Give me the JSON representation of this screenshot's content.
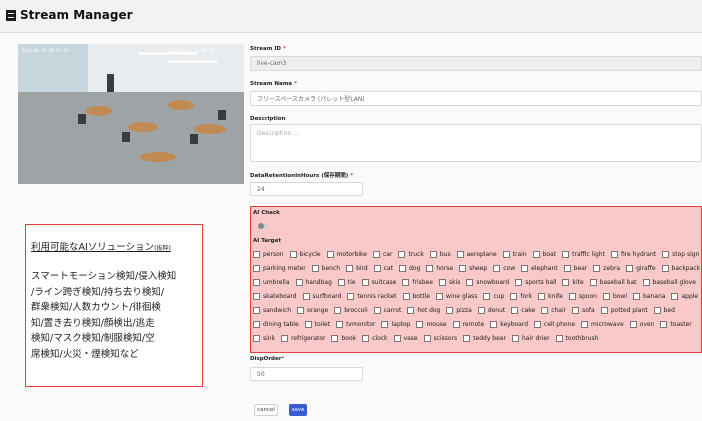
{
  "window": {
    "title": "Stream Manager"
  },
  "camera": {
    "overlay_left": "2021-06-25 18:12:33",
    "overlay_right": "2021-06-23 19:46:19"
  },
  "solution": {
    "title": "利用可能なAIソリューション",
    "title_note": "(抜粋)",
    "lines": [
      "スマートモーション検知/侵入検知",
      "/ライン跨ぎ検知/持ち去り検知/",
      "群衆検知/人数カウント/徘徊検",
      "知/置き去り検知/顔検出/逃走",
      "検知/マスク検知/制服検知/空",
      "席検知/火災・煙検知など"
    ]
  },
  "form": {
    "stream_id": {
      "label": "Stream ID",
      "value": "live-cam3"
    },
    "stream_name": {
      "label": "Stream Name",
      "value": "フリースペースカメラ (パレット型LAN)"
    },
    "description": {
      "label": "Description",
      "placeholder": "Description ..."
    },
    "retention": {
      "label": "DataRetentionInHours (保存期間)",
      "value": "24"
    },
    "ai_check": {
      "label": "AI Check"
    },
    "ai_target": {
      "label": "AI Target",
      "options": [
        "person",
        "bicycle",
        "motorbike",
        "car",
        "truck",
        "bus",
        "aeroplane",
        "train",
        "boat",
        "traffic light",
        "fire hydrant",
        "stop sign",
        "parking meter",
        "bench",
        "bird",
        "cat",
        "dog",
        "horse",
        "sheep",
        "cow",
        "elephant",
        "bear",
        "zebra",
        "giraffe",
        "backpack",
        "umbrella",
        "handbag",
        "tie",
        "suitcase",
        "frisbee",
        "skis",
        "snowboard",
        "sports ball",
        "kite",
        "baseball bat",
        "baseball glove",
        "skateboard",
        "surfboard",
        "tennis racket",
        "bottle",
        "wine glass",
        "cup",
        "fork",
        "knife",
        "spoon",
        "bowl",
        "banana",
        "apple",
        "sandwich",
        "orange",
        "broccoli",
        "carrot",
        "hot dog",
        "pizza",
        "donut",
        "cake",
        "chair",
        "sofa",
        "potted plant",
        "bed",
        "dining table",
        "toilet",
        "tvmonitor",
        "laptop",
        "mouse",
        "remote",
        "keyboard",
        "cell phone",
        "microwave",
        "oven",
        "toaster",
        "sink",
        "refrigerator",
        "book",
        "clock",
        "vase",
        "scissors",
        "teddy bear",
        "hair drier",
        "toothbrush"
      ]
    },
    "disp_order": {
      "label": "DispOrder",
      "value": "50"
    }
  },
  "buttons": {
    "cancel": "cancel",
    "save": "save"
  },
  "colors": {
    "highlight_border": "#e04040",
    "highlight_fill": "#f9c8c8",
    "primary": "#3b5bcf"
  }
}
